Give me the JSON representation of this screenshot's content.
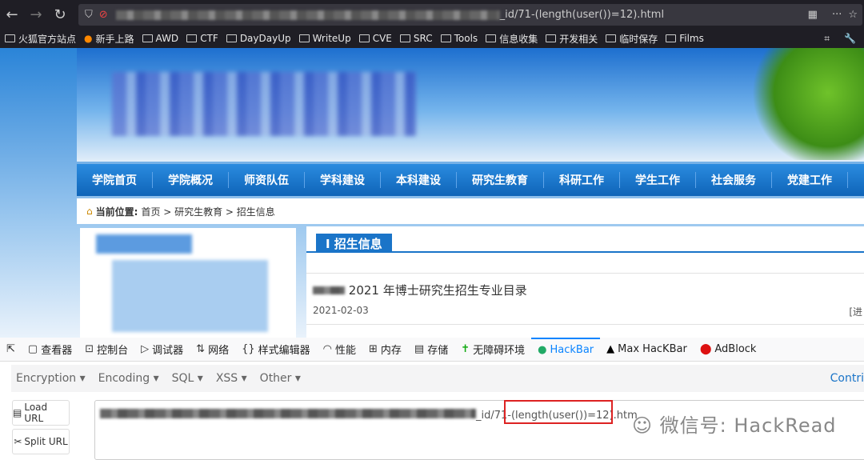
{
  "browser": {
    "url_visible": "_id/71-(length(user())=12).html",
    "bookmarks": [
      "火狐官方站点",
      "新手上路",
      "AWD",
      "CTF",
      "DayDayUp",
      "WriteUp",
      "CVE",
      "SRC",
      "Tools",
      "信息收集",
      "开发相关",
      "临时保存",
      "Films"
    ]
  },
  "site": {
    "nav": [
      "学院首页",
      "学院概况",
      "师资队伍",
      "学科建设",
      "本科建设",
      "研究生教育",
      "科研工作",
      "学生工作",
      "社会服务",
      "党建工作"
    ],
    "breadcrumb_label": "当前位置:",
    "breadcrumb": "首页 > 研究生教育 > 招生信息",
    "section_title": "I 招生信息",
    "items": [
      {
        "title": "2021 年博士研究生招生专业目录",
        "date": "2021-02-03",
        "more": "[进"
      }
    ]
  },
  "devtools": {
    "tabs": [
      "查看器",
      "控制台",
      "调试器",
      "网络",
      "样式编辑器",
      "性能",
      "内存",
      "存储",
      "无障碍环境",
      "HackBar",
      "Max HacKBar",
      "AdBlock"
    ]
  },
  "hackbar": {
    "menus": [
      "Encryption ▾",
      "Encoding ▾",
      "SQL ▾",
      "XSS ▾",
      "Other ▾"
    ],
    "contrib": "Contri",
    "load_url": "Load URL",
    "split_url": "Split URL",
    "url_prefix": "_id/71",
    "url_payload": "-(length(user())=12)",
    "url_suffix": ".htm"
  },
  "watermark": "微信号: HackRead"
}
